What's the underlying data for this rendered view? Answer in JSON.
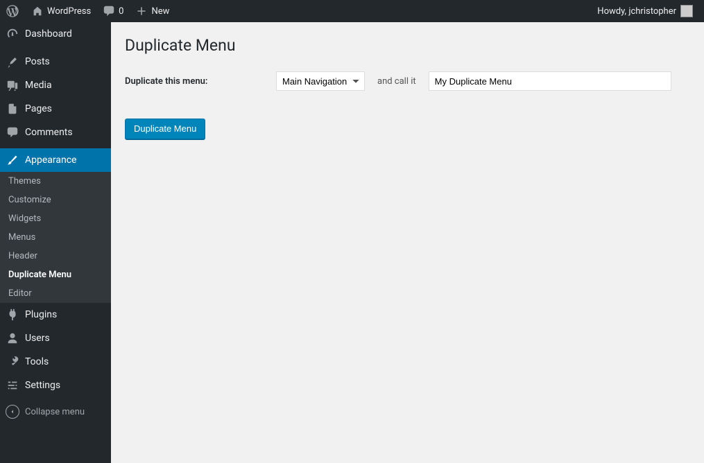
{
  "adminbar": {
    "site_name": "WordPress",
    "comments_count": "0",
    "new_label": "New",
    "howdy": "Howdy, jchristopher"
  },
  "sidebar": {
    "items": [
      {
        "id": "dashboard",
        "label": "Dashboard",
        "icon": "dashboard-icon"
      },
      {
        "id": "posts",
        "label": "Posts",
        "icon": "pin-icon"
      },
      {
        "id": "media",
        "label": "Media",
        "icon": "media-icon"
      },
      {
        "id": "pages",
        "label": "Pages",
        "icon": "pages-icon"
      },
      {
        "id": "comments",
        "label": "Comments",
        "icon": "comment-icon"
      },
      {
        "id": "appearance",
        "label": "Appearance",
        "icon": "brush-icon"
      },
      {
        "id": "plugins",
        "label": "Plugins",
        "icon": "plug-icon"
      },
      {
        "id": "users",
        "label": "Users",
        "icon": "user-icon"
      },
      {
        "id": "tools",
        "label": "Tools",
        "icon": "wrench-icon"
      },
      {
        "id": "settings",
        "label": "Settings",
        "icon": "sliders-icon"
      }
    ],
    "appearance_submenu": [
      "Themes",
      "Customize",
      "Widgets",
      "Menus",
      "Header",
      "Duplicate Menu",
      "Editor"
    ],
    "current_submenu": "Duplicate Menu",
    "collapse_label": "Collapse menu"
  },
  "page": {
    "title": "Duplicate Menu",
    "label_duplicate": "Duplicate this menu:",
    "select_value": "Main Navigation",
    "between_text": "and call it",
    "input_value": "My Duplicate Menu",
    "button_label": "Duplicate Menu"
  }
}
